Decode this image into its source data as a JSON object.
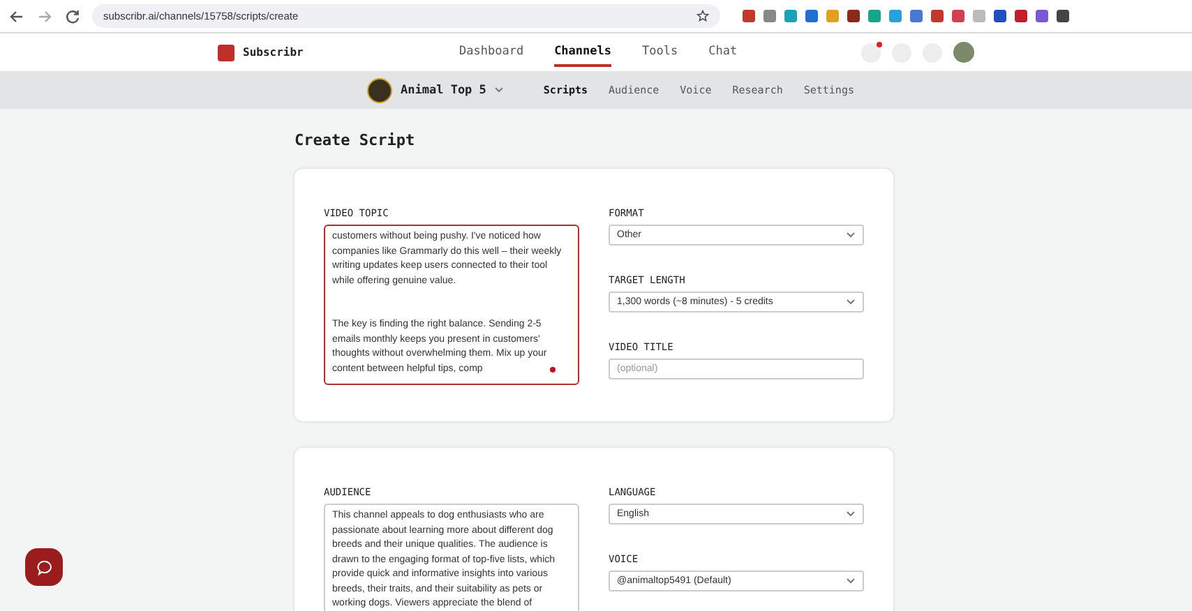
{
  "browser": {
    "url": "subscribr.ai/channels/15758/scripts/create"
  },
  "header": {
    "brand": "Subscribr",
    "nav": [
      {
        "label": "Dashboard",
        "selected": false
      },
      {
        "label": "Channels",
        "selected": true
      },
      {
        "label": "Tools",
        "selected": false
      },
      {
        "label": "Chat",
        "selected": false
      }
    ],
    "notification_dot": true
  },
  "subnav": {
    "channel": "Animal Top 5",
    "tabs": [
      {
        "label": "Scripts",
        "selected": true
      },
      {
        "label": "Audience",
        "selected": false
      },
      {
        "label": "Voice",
        "selected": false
      },
      {
        "label": "Research",
        "selected": false
      },
      {
        "label": "Settings",
        "selected": false
      }
    ]
  },
  "page_title": "Create Script",
  "cards": [
    {
      "left": {
        "label": "VIDEO TOPIC",
        "value": "customers without being pushy. I've noticed how companies like Grammarly do this well – their weekly writing updates keep users connected to their tool while offering genuine value.\n\n\nThe key is finding the right balance. Sending 2-5 emails monthly keeps you present in customers' thoughts without overwhelming them. Mix up your content between helpful tips, comp",
        "focused": true
      },
      "right": [
        {
          "kind": "select",
          "label": "FORMAT",
          "value": "Other"
        },
        {
          "kind": "select",
          "label": "TARGET LENGTH",
          "value": "1,300 words (~8 minutes) - 5 credits"
        },
        {
          "kind": "input",
          "label": "VIDEO TITLE",
          "placeholder": "(optional)"
        }
      ]
    },
    {
      "left": {
        "label": "AUDIENCE",
        "value": "This channel appeals to dog enthusiasts who are passionate about learning more about different dog breeds and their unique qualities. The audience is drawn to the engaging format of top-five lists, which provide quick and informative insights into various breeds, their traits, and their suitability as pets or working dogs. Viewers appreciate the blend of",
        "focused": false
      },
      "right": [
        {
          "kind": "select",
          "label": "LANGUAGE",
          "value": "English"
        },
        {
          "kind": "select",
          "label": "VOICE",
          "value": "@animaltop5491 (Default)"
        }
      ]
    }
  ]
}
